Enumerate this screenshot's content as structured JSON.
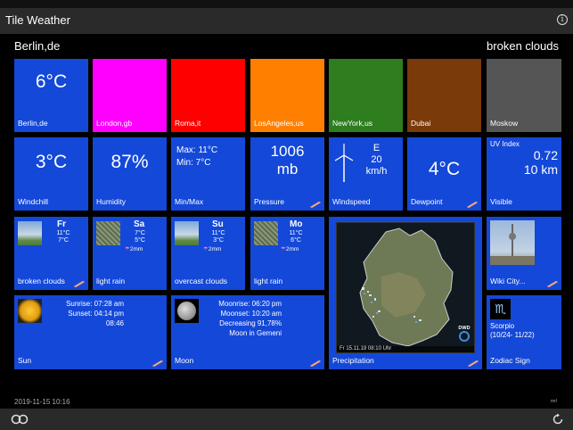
{
  "app": {
    "title": "Tile Weather"
  },
  "location": {
    "city": "Berlin,de",
    "condition": "broken clouds"
  },
  "cities": [
    {
      "name": "Berlin,de",
      "temp": "6°C",
      "color": "#1448d8"
    },
    {
      "name": "London,gb",
      "color": "#ff00ff"
    },
    {
      "name": "Roma,it",
      "color": "#ff0000"
    },
    {
      "name": "LosAngeles,us",
      "color": "#ff8000"
    },
    {
      "name": "NewYork,us",
      "color": "#2e7d1f"
    },
    {
      "name": "Dubai",
      "color": "#7a3a0a"
    },
    {
      "name": "Moskow",
      "color": "#555555"
    }
  ],
  "stats": {
    "windchill": {
      "value": "3°C",
      "label": "Windchill"
    },
    "humidity": {
      "value": "87%",
      "label": "Humidity"
    },
    "minmax": {
      "max": "Max: 11°C",
      "min": "Min: 7°C",
      "label": "Min/Max"
    },
    "pressure": {
      "value": "1006",
      "unit": "mb",
      "label": "Pressure"
    },
    "wind": {
      "dir": "E",
      "speed": "20",
      "unit": "km/h",
      "label": "Windspeed"
    },
    "dewpoint": {
      "value": "4°C",
      "label": "Dewpoint"
    },
    "visible": {
      "uv_title": "UV Index",
      "uv": "0.72",
      "distance": "10 km",
      "label": "Visible"
    }
  },
  "forecast": [
    {
      "day": "Fr",
      "hi": "11°C",
      "lo": "7°C",
      "rain": "",
      "label": "broken clouds"
    },
    {
      "day": "Sa",
      "hi": "7°C",
      "lo": "5°C",
      "rain": "2mm",
      "label": "light rain"
    },
    {
      "day": "Su",
      "hi": "11°C",
      "lo": "3°C",
      "rain": "2mm",
      "label": "overcast clouds"
    },
    {
      "day": "Mo",
      "hi": "11°C",
      "lo": "6°C",
      "rain": "2mm",
      "label": "light rain"
    }
  ],
  "sun": {
    "rise": "Sunrise: 07:28 am",
    "set": "Sunset: 04:14 pm",
    "duration": "08:46",
    "label": "Sun"
  },
  "moon": {
    "rise": "Moonrise: 06:20 pm",
    "set": "Moonset: 10:20 am",
    "phase": "Decreasing  91,78%",
    "sign": "Moon in Gemeni",
    "label": "Moon"
  },
  "precip": {
    "label": "Precipitation",
    "stamp": "Fr 15.11.19  08:10 Uhr",
    "brand": "DWD"
  },
  "wiki": {
    "label": "Wiki City..."
  },
  "zodiac": {
    "name": "Scorpio",
    "range": "(10/24- 11/22)",
    "label": "Zodiac Sign"
  },
  "footer": {
    "timestamp": "2019-11-15 10:16",
    "mark": "mrl"
  },
  "icons": [
    "info-icon",
    "link-icon",
    "refresh-icon",
    "edit-icon"
  ]
}
